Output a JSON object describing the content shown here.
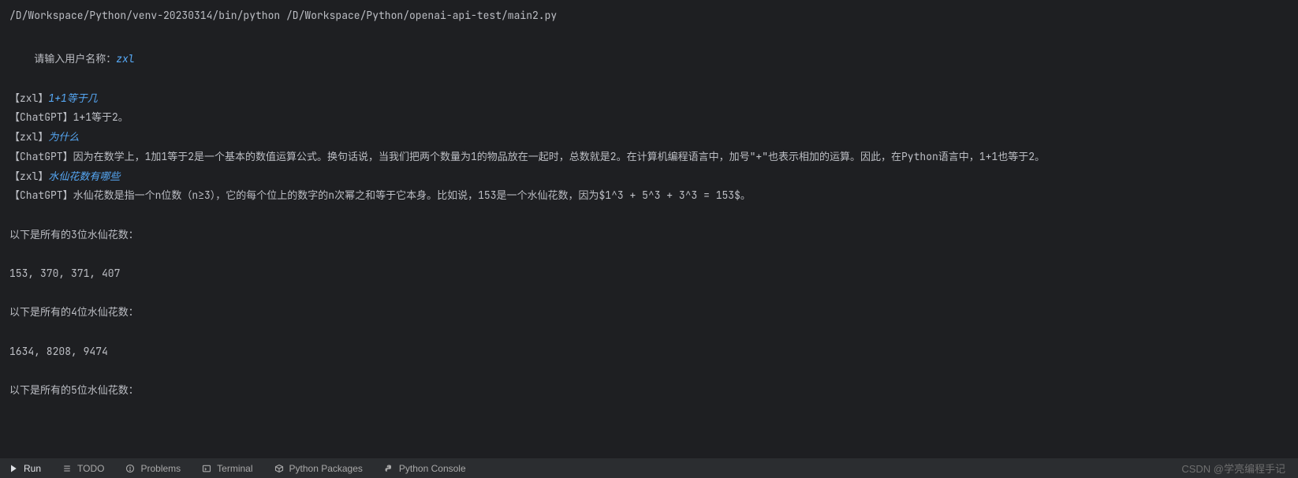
{
  "command": "/D/Workspace/Python/venv-20230314/bin/python /D/Workspace/Python/openai-api-test/main2.py",
  "promptLabel": "请输入用户名称：",
  "username": "zxl",
  "dialog": [
    {
      "role": "user",
      "name": "zxl",
      "text": "1+1等于几"
    },
    {
      "role": "bot",
      "name": "ChatGPT",
      "text": "1+1等于2。"
    },
    {
      "role": "user",
      "name": "zxl",
      "text": "为什么"
    },
    {
      "role": "bot",
      "name": "ChatGPT",
      "text": "因为在数学上，1加1等于2是一个基本的数值运算公式。换句话说，当我们把两个数量为1的物品放在一起时，总数就是2。在计算机编程语言中，加号\"+\"也表示相加的运算。因此，在Python语言中，1+1也等于2。"
    },
    {
      "role": "user",
      "name": "zxl",
      "text": "水仙花数有哪些"
    },
    {
      "role": "bot",
      "name": "ChatGPT",
      "text": "水仙花数是指一个n位数（n≥3），它的每个位上的数字的n次幂之和等于它本身。比如说，153是一个水仙花数，因为$1^3 + 5^3 + 3^3 = 153$。"
    }
  ],
  "extraLines": [
    "",
    "以下是所有的3位水仙花数：",
    "",
    "153, 370, 371, 407",
    "",
    "以下是所有的4位水仙花数：",
    "",
    "1634, 8208, 9474",
    "",
    "以下是所有的5位水仙花数："
  ],
  "tabs": {
    "run": "Run",
    "todo": "TODO",
    "problems": "Problems",
    "terminal": "Terminal",
    "pythonPackages": "Python Packages",
    "pythonConsole": "Python Console"
  },
  "watermark": "CSDN @学亮编程手记"
}
